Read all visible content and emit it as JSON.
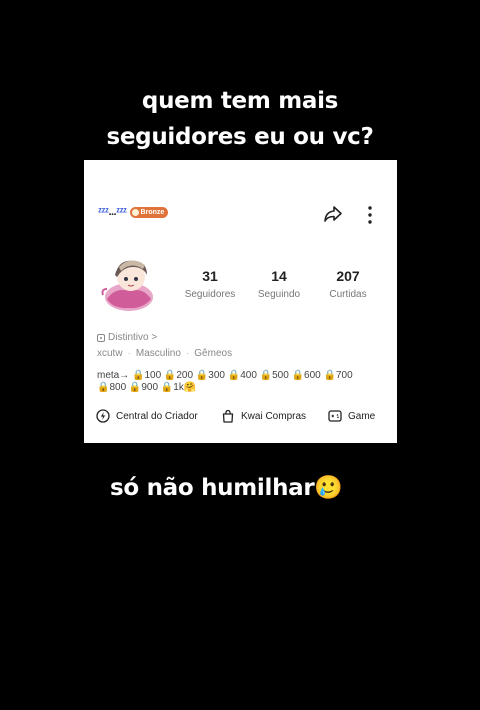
{
  "caption_top": [
    "quem tem mais",
    "seguidores eu ou vc?"
  ],
  "caption_bottom": "só não humilhar🥲",
  "profile": {
    "name_prefix": "ᶻᶻᶻ",
    "name_dots": "...",
    "name_suffix": "ᶻᶻᶻ",
    "badge_label": "Bronze",
    "avatar_icon": "anime-avatar-icon",
    "stats": [
      {
        "value": "31",
        "label": "Seguidores"
      },
      {
        "value": "14",
        "label": "Seguindo"
      },
      {
        "value": "207",
        "label": "Curtidas"
      }
    ],
    "distintivo_label": "Distintivo >",
    "username": "xcutw",
    "gender": "Masculino",
    "sign": "Gêmeos",
    "bio_line1": "meta→ 🔒100 🔒200 🔒300 🔒400 🔒500 🔒600 🔒700",
    "bio_line2": "🔒800 🔒900 🔒1k🤗"
  },
  "actions": [
    {
      "label": "Central do Criador",
      "icon": "lightning-circle-icon"
    },
    {
      "label": "Kwai Compras",
      "icon": "shopping-bag-icon"
    },
    {
      "label": "Game",
      "icon": "gamepad-icon"
    }
  ],
  "colors": {
    "background": "#000000",
    "card": "#ffffff",
    "badge": "#e0733a",
    "accent": "#3b5bdb"
  }
}
